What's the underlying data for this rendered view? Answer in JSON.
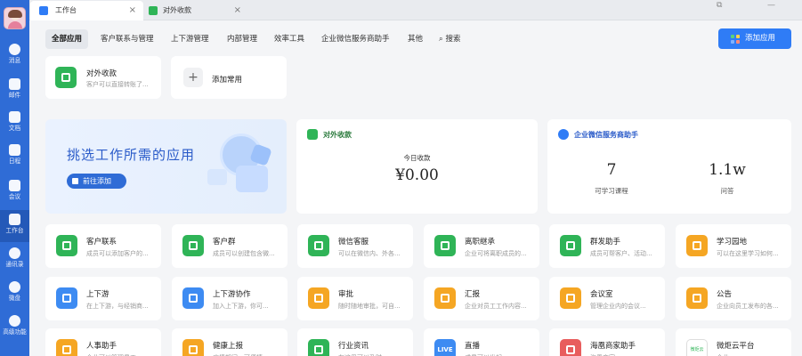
{
  "tabs": [
    {
      "label": "工作台"
    },
    {
      "label": "对外收款"
    }
  ],
  "sidebar": [
    {
      "label": "消息"
    },
    {
      "label": "邮件"
    },
    {
      "label": "文档"
    },
    {
      "label": "日程"
    },
    {
      "label": "会议"
    },
    {
      "label": "工作台"
    },
    {
      "label": "通讯录"
    },
    {
      "label": "微盘"
    },
    {
      "label": "高级功能"
    }
  ],
  "categories": [
    "全部应用",
    "客户联系与管理",
    "上下游管理",
    "内部管理",
    "效率工具",
    "企业微信服务商助手",
    "其他",
    "搜索"
  ],
  "add_app_label": "添加应用",
  "favorites": {
    "app": {
      "title": "对外收款",
      "desc": "客户可以直接转账了..."
    },
    "add_label": "添加常用"
  },
  "banner": {
    "title": "挑选工作所需的应用",
    "button": "前往添加"
  },
  "money_card": {
    "title": "对外收款",
    "label": "今日收款",
    "value": "¥0.00"
  },
  "stats_card": {
    "title": "企业微信服务商助手",
    "items": [
      {
        "value": "7",
        "label": "可学习课程"
      },
      {
        "value": "1.1w",
        "label": "问答"
      }
    ]
  },
  "apps": [
    {
      "title": "客户联系",
      "desc": "成员可以添加客户的...",
      "color": "#2fb457"
    },
    {
      "title": "客户群",
      "desc": "成员可以创建包含微...",
      "color": "#2fb457"
    },
    {
      "title": "微信客服",
      "desc": "可以在微信内、外各...",
      "color": "#2fb457"
    },
    {
      "title": "离职继承",
      "desc": "企业可将离职成员的...",
      "color": "#2fb457"
    },
    {
      "title": "群发助手",
      "desc": "成员可帮客户、活动...",
      "color": "#2fb457"
    },
    {
      "title": "学习园地",
      "desc": "可以在这里学习如何...",
      "color": "#f5a623"
    },
    {
      "title": "上下游",
      "desc": "在上下游，与经销商...",
      "color": "#3d8bf2"
    },
    {
      "title": "上下游协作",
      "desc": "加入上下游，你可...",
      "color": "#3d8bf2"
    },
    {
      "title": "审批",
      "desc": "随时随地审批，可自...",
      "color": "#f5a623"
    },
    {
      "title": "汇报",
      "desc": "企业对员工工作内容...",
      "color": "#f5a623"
    },
    {
      "title": "会议室",
      "desc": "管理企业内的会议...",
      "color": "#f5a623"
    },
    {
      "title": "公告",
      "desc": "企业向员工发布的各...",
      "color": "#f5a623"
    },
    {
      "title": "人事助手",
      "desc": "企业可以管理员工...",
      "color": "#f5a623"
    },
    {
      "title": "健康上报",
      "desc": "疫情期间，可便捷...",
      "color": "#f5a623"
    },
    {
      "title": "行业资讯",
      "desc": "在这里可以及时...",
      "color": "#2fb457"
    },
    {
      "title": "直播",
      "desc": "成员可以发起...",
      "color": "#3d8bf2",
      "badge": "LIVE"
    },
    {
      "title": "海凰商家助手",
      "desc": "海凰商家...",
      "color": "#e85d5d"
    },
    {
      "title": "微炬云平台",
      "desc": "企业...",
      "color": "#ffffff",
      "brand": "微炬云"
    }
  ]
}
